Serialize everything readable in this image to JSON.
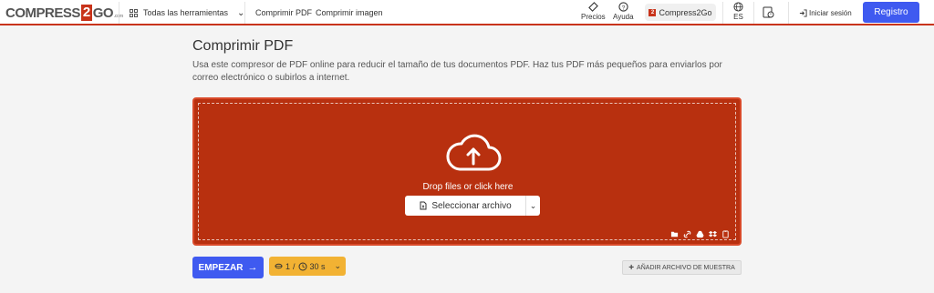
{
  "header": {
    "logo": {
      "left": "COMPRESS",
      "mid": "2",
      "right": "GO",
      "suffix": ".com"
    },
    "tools_label": "Todas las herramientas",
    "links": [
      "Comprimir PDF",
      "Comprimir imagen"
    ],
    "prices_label": "Precios",
    "help_label": "Ayuda",
    "brand_pill": "Compress2Go",
    "lang": "ES",
    "login_label": "Iniciar sesión",
    "register_label": "Registro"
  },
  "main": {
    "title": "Comprimir PDF",
    "description": "Usa este compresor de PDF online para reducir el tamaño de tus documentos PDF. Haz tus PDF más pequeños para enviarlos por correo electrónico o subirlos a internet.",
    "drop_text": "Drop files or click here",
    "select_label": "Seleccionar archivo",
    "start_label": "EMPEZAR",
    "limit_files": "1",
    "limit_sep": "/",
    "limit_time": "30 s",
    "sample_label": "AÑADIR ARCHIVO DE MUESTRA"
  },
  "colors": {
    "brand": "#c8331a",
    "drop_bg": "#b8300f",
    "primary": "#3f5af0",
    "limit_bg": "#f2b233"
  }
}
